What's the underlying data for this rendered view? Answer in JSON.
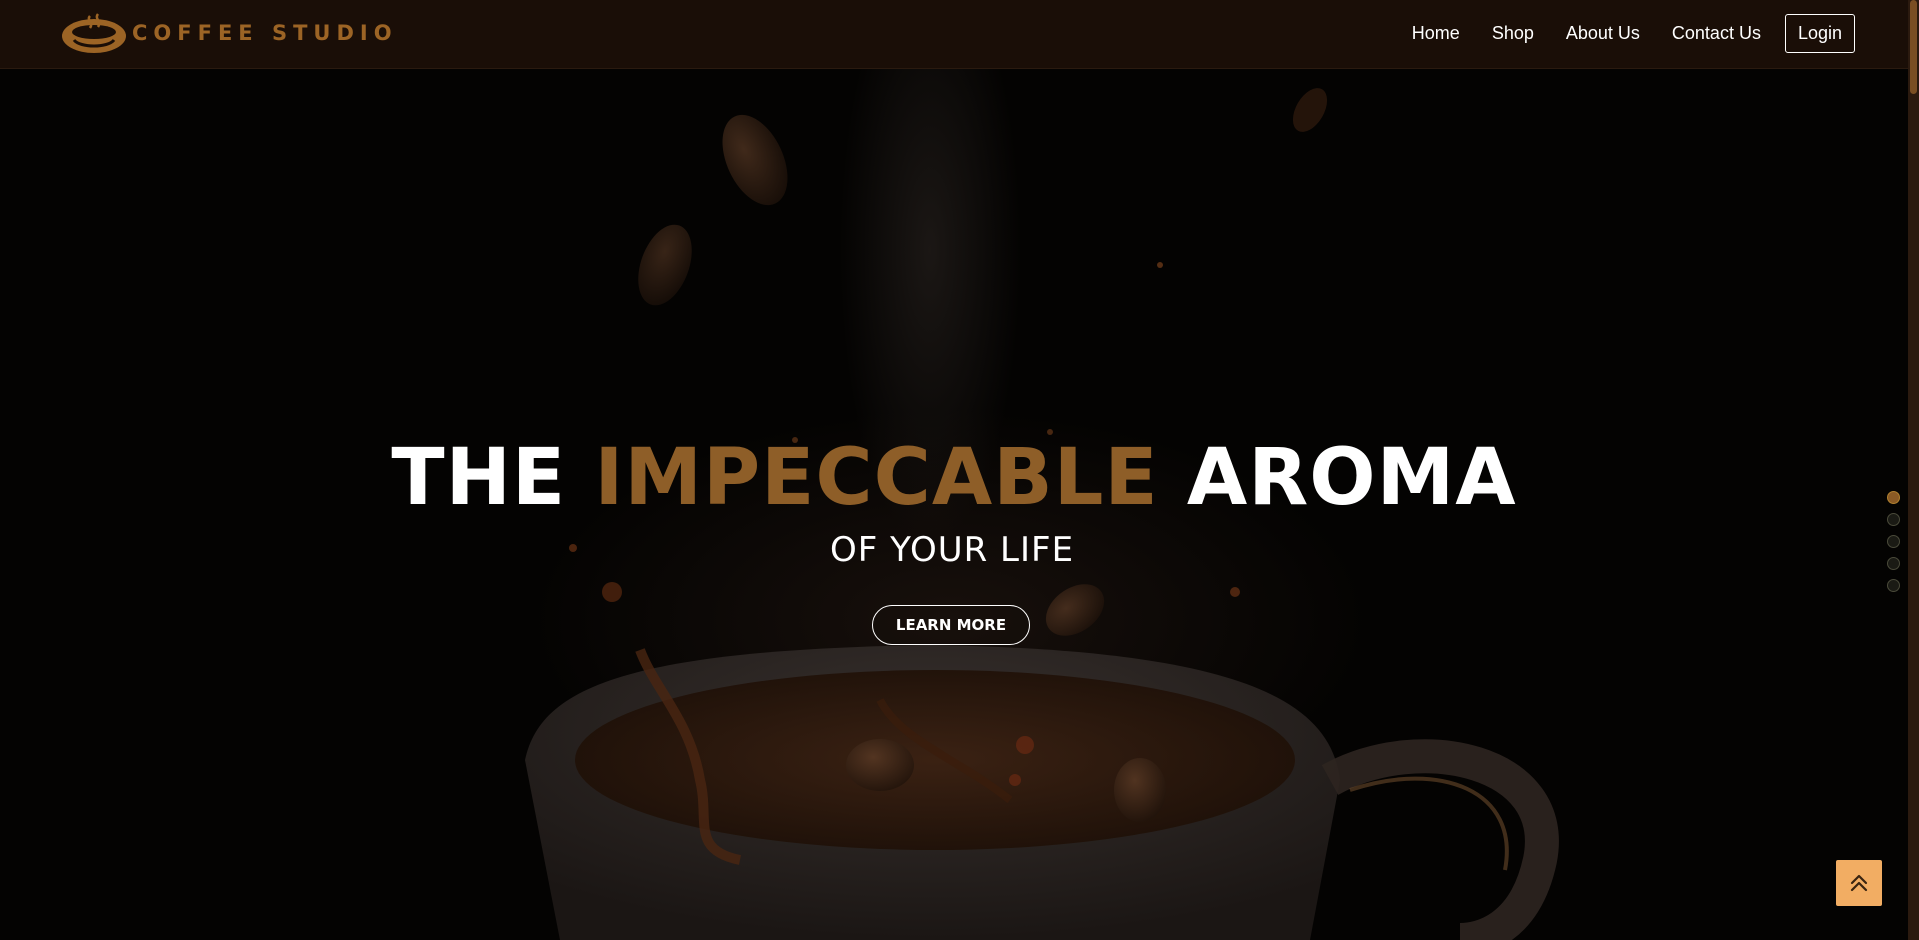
{
  "brand": {
    "name": "COFFEE STUDIO",
    "logo_icon": "coffee-cup-logo-icon",
    "color": "#9c6425"
  },
  "nav": {
    "items": [
      {
        "label": "Home"
      },
      {
        "label": "Shop"
      },
      {
        "label": "About Us"
      },
      {
        "label": "Contact Us"
      }
    ],
    "login_label": "Login"
  },
  "hero": {
    "headline_part1": "THE",
    "headline_accent": "IMPECCABLE",
    "headline_part2": "AROMA",
    "subheadline": "OF YOUR LIFE",
    "cta_label": "LEARN MORE",
    "background_image": "coffee cup with splashing coffee beans",
    "accent_color": "#8e5e28"
  },
  "slider": {
    "dot_count": 5,
    "active_index": 0
  },
  "back_to_top": {
    "icon": "double-chevron-up-icon",
    "color": "#f2ad63"
  }
}
